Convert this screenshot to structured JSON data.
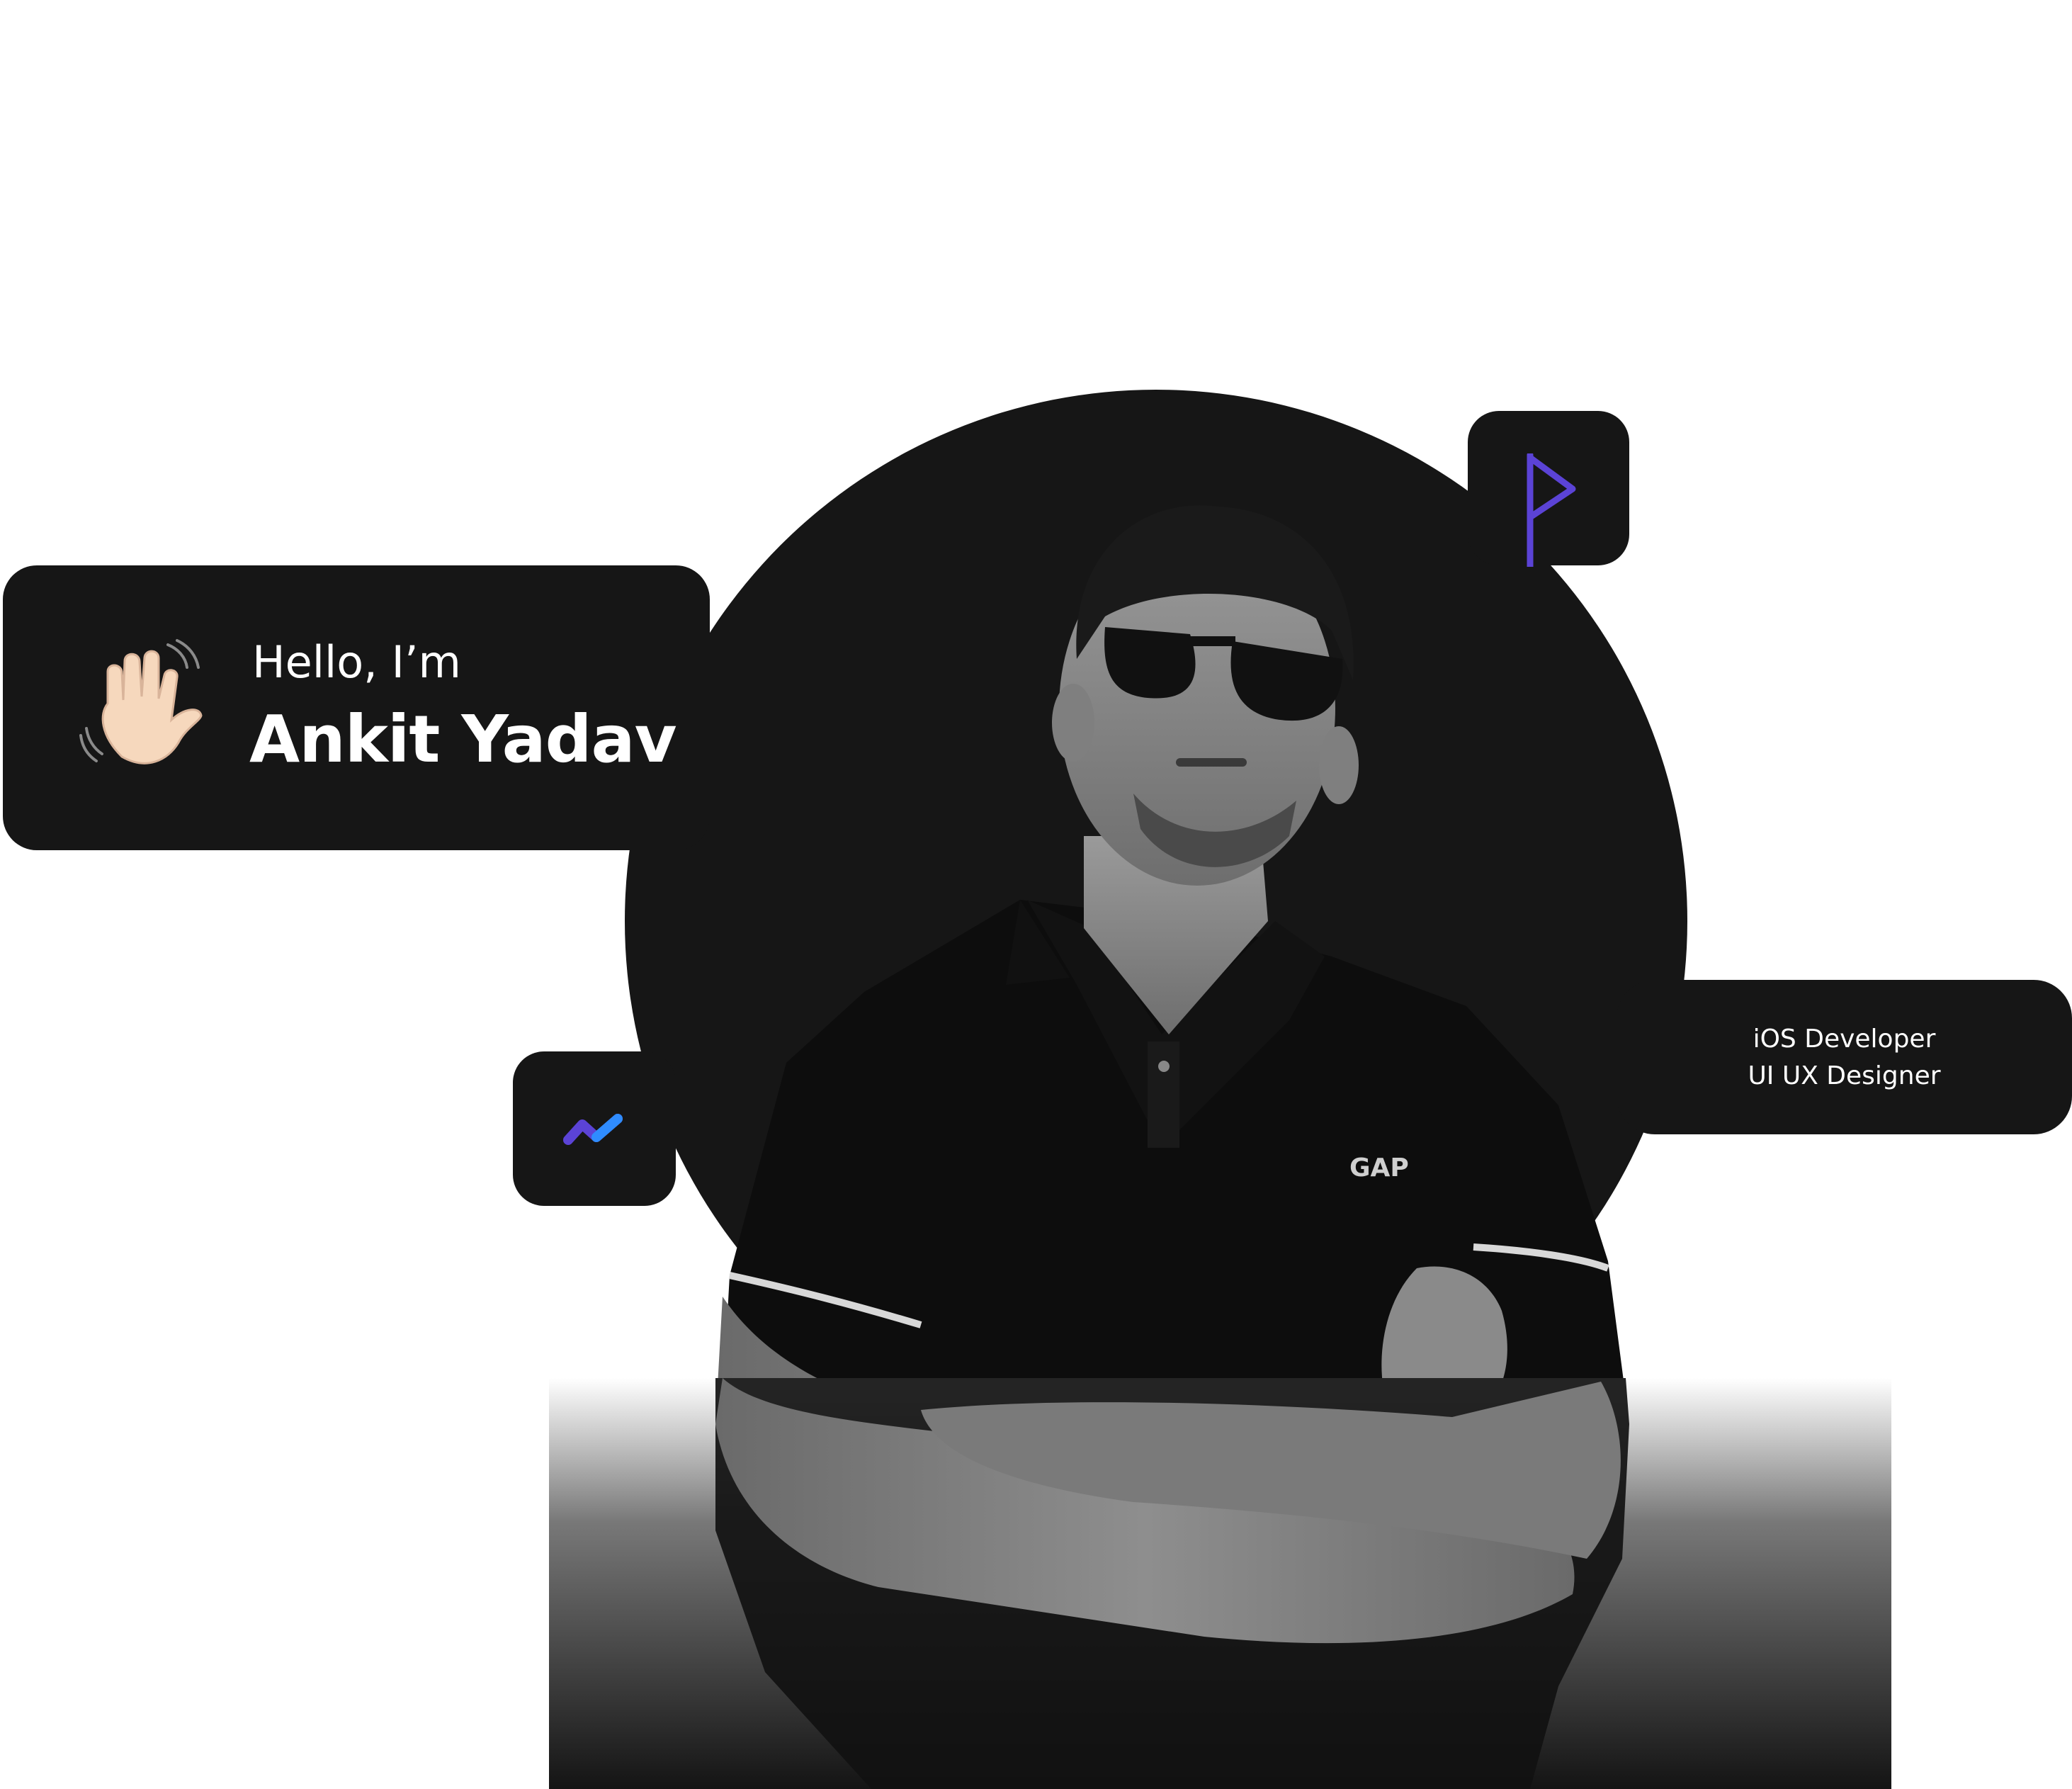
{
  "hero": {
    "greeting": "Hello, I’m",
    "name": "Ankit Yadav",
    "greeting_icon": "waving-hand-icon"
  },
  "roles": {
    "line1": "iOS Developer",
    "line2": "UI UX Designer"
  },
  "badges": {
    "flag_icon": "flag-icon",
    "trend_icon": "trend-logo-icon"
  },
  "colors": {
    "card_bg": "#161616",
    "accent_purple": "#5b43d6",
    "accent_blue": "#2f8cff",
    "text": "#ffffff"
  },
  "portrait": {
    "shirt_logo": "GAP"
  }
}
